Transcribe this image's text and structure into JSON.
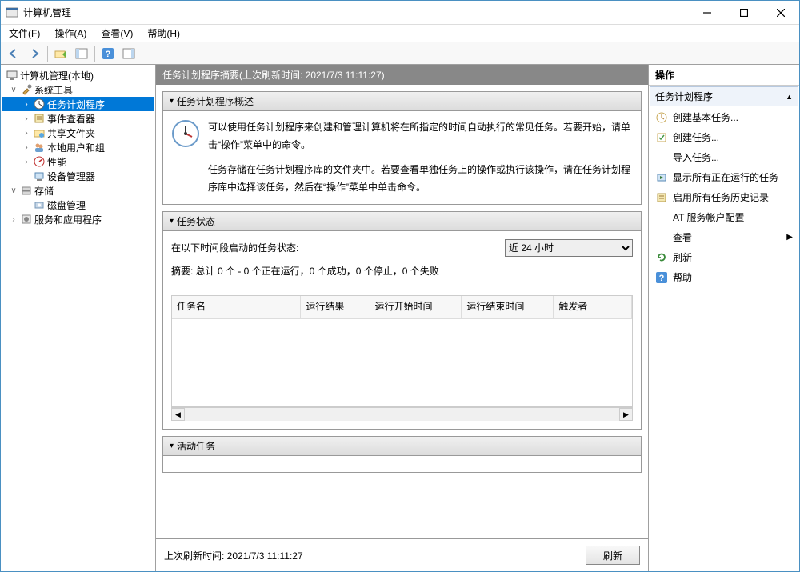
{
  "window": {
    "title": "计算机管理"
  },
  "menubar": {
    "file": "文件(F)",
    "action": "操作(A)",
    "view": "查看(V)",
    "help": "帮助(H)"
  },
  "tree": {
    "root": "计算机管理(本地)",
    "system_tools": "系统工具",
    "task_scheduler": "任务计划程序",
    "event_viewer": "事件查看器",
    "shared_folders": "共享文件夹",
    "local_users": "本地用户和组",
    "performance": "性能",
    "device_manager": "设备管理器",
    "storage": "存储",
    "disk_mgmt": "磁盘管理",
    "services_apps": "服务和应用程序"
  },
  "center": {
    "header": "任务计划程序摘要(上次刷新时间: 2021/7/3 11:11:27)",
    "overview_title": "任务计划程序概述",
    "overview_p1": "可以使用任务计划程序来创建和管理计算机将在所指定的时间自动执行的常见任务。若要开始，请单击“操作”菜单中的命令。",
    "overview_p2": "任务存储在任务计划程序库的文件夹中。若要查看单独任务上的操作或执行该操作，请在任务计划程序库中选择该任务，然后在“操作”菜单中单击命令。",
    "status_title": "任务状态",
    "status_label": "在以下时间段启动的任务状态:",
    "status_select_options": [
      "近 24 小时"
    ],
    "status_summary": "摘要: 总计 0 个 - 0 个正在运行，0 个成功，0 个停止，0 个失败",
    "table_headers": {
      "name": "任务名",
      "result": "运行结果",
      "start": "运行开始时间",
      "end": "运行结束时间",
      "trigger": "触发者"
    },
    "active_title": "活动任务",
    "footer_time": "上次刷新时间: 2021/7/3 11:11:27",
    "refresh_btn": "刷新"
  },
  "actions": {
    "pane_title": "操作",
    "section": "任务计划程序",
    "create_basic": "创建基本任务...",
    "create_task": "创建任务...",
    "import_task": "导入任务...",
    "show_running": "显示所有正在运行的任务",
    "enable_history": "启用所有任务历史记录",
    "at_service": "AT 服务帐户配置",
    "view": "查看",
    "refresh": "刷新",
    "help": "帮助"
  }
}
